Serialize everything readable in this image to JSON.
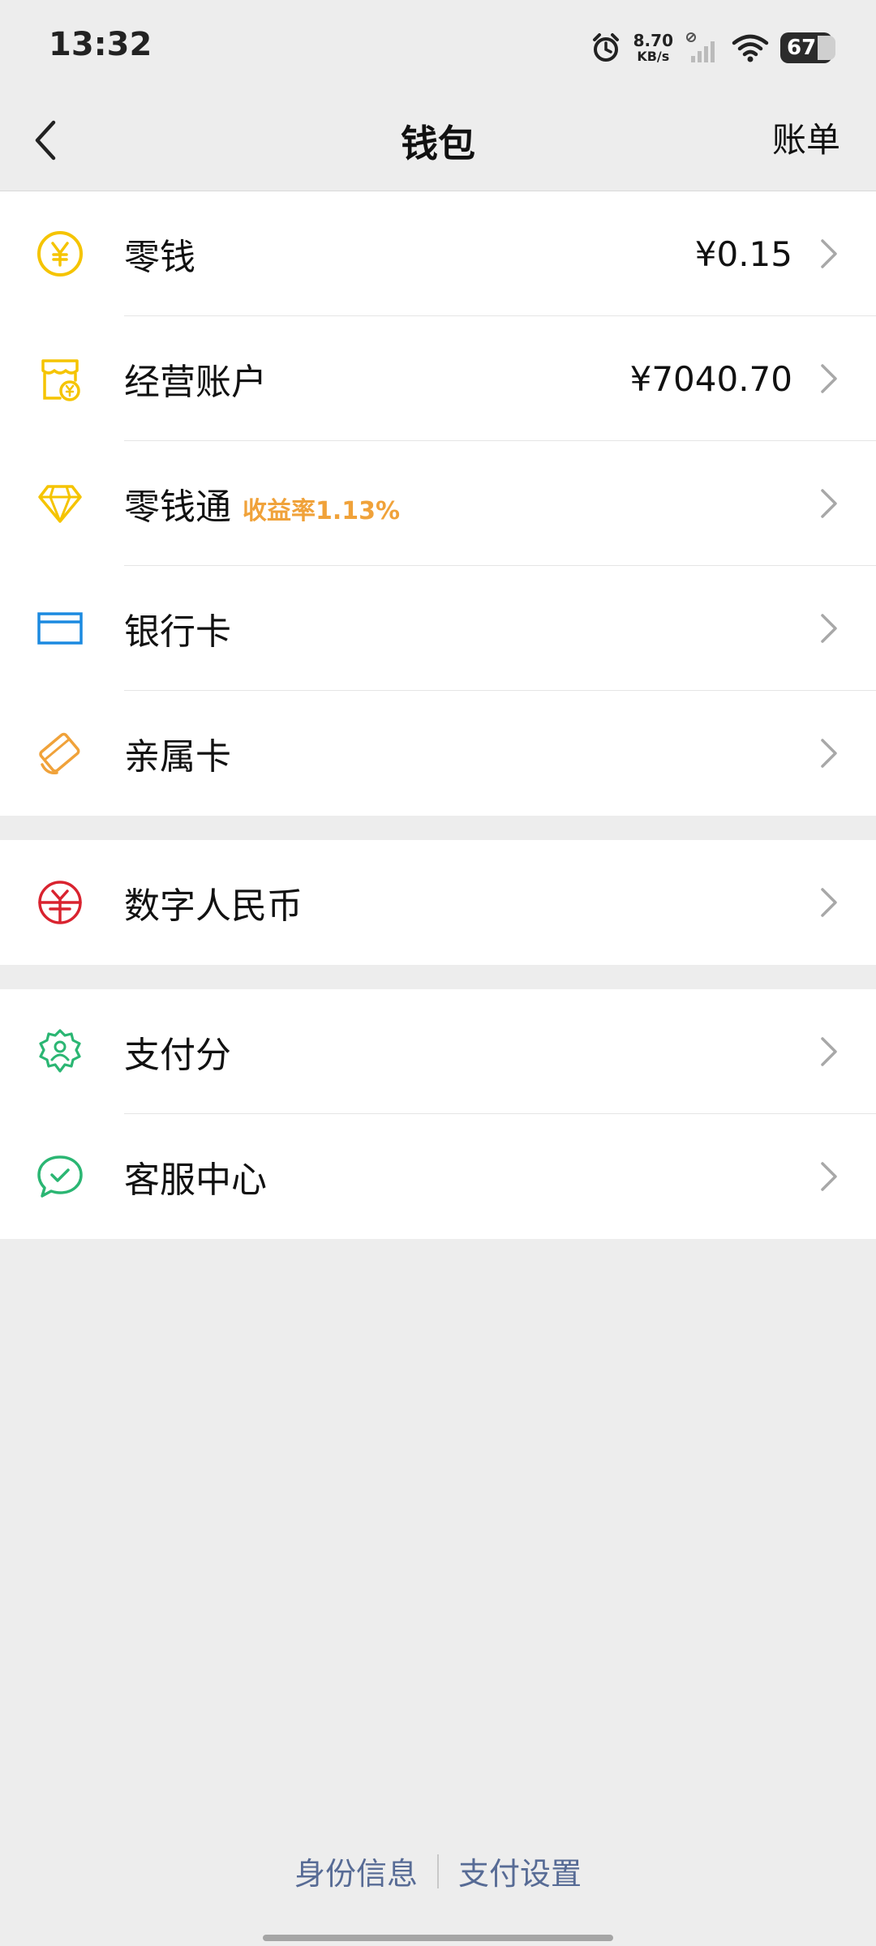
{
  "status_bar": {
    "time": "13:32",
    "net_speed_value": "8.70",
    "net_speed_unit": "KB/s",
    "battery": "67"
  },
  "nav": {
    "title": "钱包",
    "right_action": "账单"
  },
  "groups": [
    {
      "items": [
        {
          "label": "零钱",
          "value": "¥0.15",
          "icon": "yuan-coin-icon",
          "color": "#f5c400"
        },
        {
          "label": "经营账户",
          "value": "¥7040.70",
          "icon": "store-icon",
          "color": "#f5c400"
        },
        {
          "label": "零钱通",
          "tag": "收益率1.13%",
          "icon": "diamond-icon",
          "color": "#f5c400"
        },
        {
          "label": "银行卡",
          "icon": "bank-card-icon",
          "color": "#1b8ae0"
        },
        {
          "label": "亲属卡",
          "icon": "family-card-icon",
          "color": "#f0a23a"
        }
      ]
    },
    {
      "items": [
        {
          "label": "数字人民币",
          "icon": "digital-rmb-icon",
          "color": "#d9232f"
        }
      ]
    },
    {
      "items": [
        {
          "label": "支付分",
          "icon": "pay-score-icon",
          "color": "#2bb673"
        },
        {
          "label": "客服中心",
          "icon": "customer-service-icon",
          "color": "#2bb673"
        }
      ]
    }
  ],
  "footer": {
    "identity": "身份信息",
    "pay_settings": "支付设置"
  },
  "colors": {
    "background": "#ededed",
    "link": "#576b95",
    "tag": "#f0a23a"
  }
}
